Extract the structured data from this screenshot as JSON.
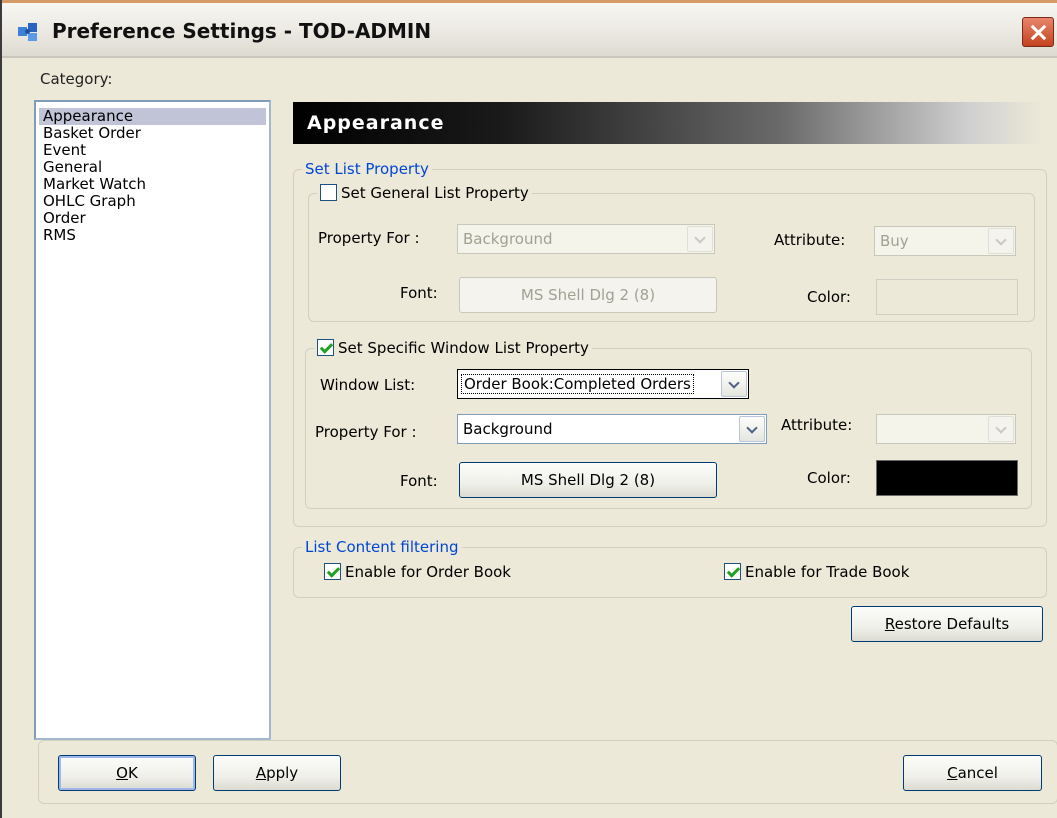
{
  "window": {
    "title": "Preference Settings - TOD-ADMIN"
  },
  "category": {
    "label": "Category:",
    "items": [
      {
        "label": "Appearance",
        "selected": true
      },
      {
        "label": "Basket Order",
        "selected": false
      },
      {
        "label": "Event",
        "selected": false
      },
      {
        "label": "General",
        "selected": false
      },
      {
        "label": "Market Watch",
        "selected": false
      },
      {
        "label": "OHLC Graph",
        "selected": false
      },
      {
        "label": "Order",
        "selected": false
      },
      {
        "label": "RMS",
        "selected": false
      }
    ]
  },
  "section": {
    "title": "Appearance"
  },
  "set_list_property": {
    "legend": "Set List Property",
    "general": {
      "checkbox_label": "Set General List Property",
      "checked": false,
      "property_for_label": "Property For :",
      "property_for_value": "Background",
      "attribute_label": "Attribute:",
      "attribute_value": "Buy",
      "font_label": "Font:",
      "font_button": "MS Shell Dlg 2 (8)",
      "color_label": "Color:",
      "color_value": "#ece9d8"
    },
    "specific": {
      "checkbox_label": "Set Specific Window List Property",
      "checked": true,
      "window_list_label": "Window List:",
      "window_list_value": "Order Book:Completed Orders",
      "property_for_label": "Property For :",
      "property_for_value": "Background",
      "attribute_label": "Attribute:",
      "attribute_value": "",
      "font_label": "Font:",
      "font_button": "MS Shell Dlg 2 (8)",
      "color_label": "Color:",
      "color_value": "#000000"
    }
  },
  "list_content_filtering": {
    "legend": "List Content filtering",
    "order_book": {
      "label": "Enable  for Order Book",
      "checked": true
    },
    "trade_book": {
      "label": "Enable for Trade Book",
      "checked": true
    }
  },
  "buttons": {
    "restore_defaults": {
      "accel": "R",
      "rest": "estore Defaults"
    },
    "ok": {
      "accel": "O",
      "rest": "K"
    },
    "apply": {
      "accel": "A",
      "rest": "pply"
    },
    "cancel": {
      "accel": "C",
      "rest": "ancel"
    }
  },
  "colors": {
    "dialog_bg": "#ece9d8",
    "legend_text": "#0046d5",
    "selection": "#c0c4d6",
    "checkmark": "#21a121"
  }
}
